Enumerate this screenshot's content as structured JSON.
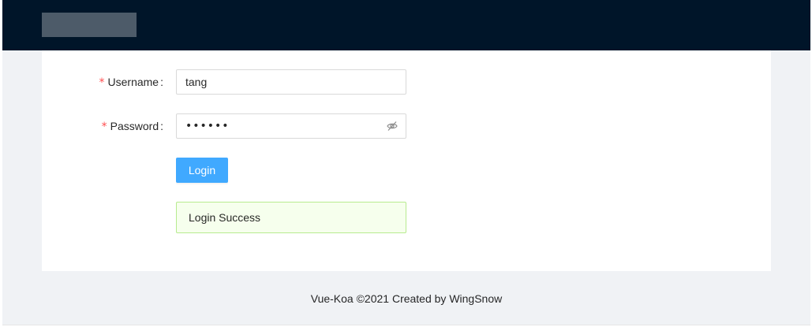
{
  "header": {
    "logo": ""
  },
  "form": {
    "username": {
      "required_mark": "*",
      "label": "Username",
      "colon": ":",
      "value": "tang"
    },
    "password": {
      "required_mark": "*",
      "label": "Password",
      "colon": ":",
      "masked_value": "••••••",
      "toggle_icon": "eye-invisible-icon"
    },
    "login_label": "Login"
  },
  "alert": {
    "type": "success",
    "message": "Login Success"
  },
  "footer": {
    "text": "Vue-Koa ©2021 Created by WingSnow"
  },
  "colors": {
    "header_bg": "#001529",
    "page_bg": "#f0f2f5",
    "primary": "#40a9ff",
    "required": "#ff4d4f",
    "success_bg": "#f6ffed",
    "success_border": "#b7eb8f"
  }
}
